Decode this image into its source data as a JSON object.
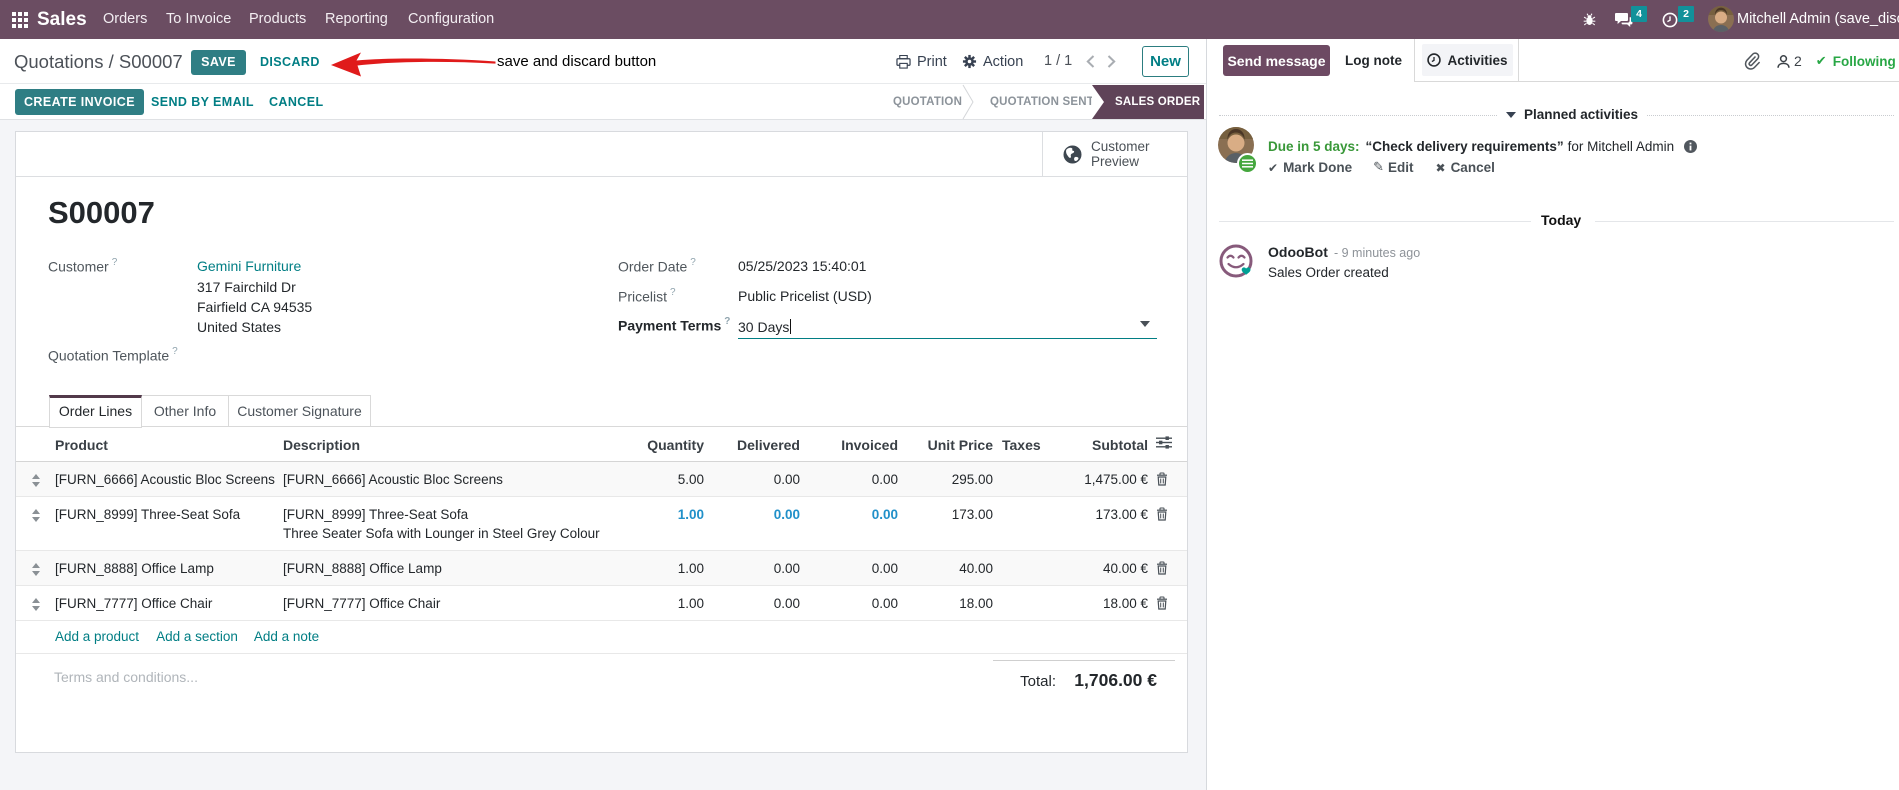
{
  "navbar": {
    "app_name": "Sales",
    "menus": [
      "Orders",
      "To Invoice",
      "Products",
      "Reporting",
      "Configuration"
    ],
    "messages_badge": "4",
    "activities_badge": "2",
    "user_name": "Mitchell Admin (save_discard"
  },
  "control_panel": {
    "breadcrumb_parent": "Quotations",
    "breadcrumb_separator": " / ",
    "breadcrumb_current": "S00007",
    "save_label": "SAVE",
    "discard_label": "DISCARD",
    "annotation_text": "save and discard button",
    "print_label": "Print",
    "action_label": "Action",
    "pager_value": "1 / 1",
    "new_label": "New"
  },
  "status_bar": {
    "create_invoice_label": "CREATE INVOICE",
    "send_by_email_label": "SEND BY EMAIL",
    "cancel_label": "CANCEL",
    "steps": [
      "QUOTATION",
      "QUOTATION SENT",
      "SALES ORDER"
    ],
    "active_step": "SALES ORDER"
  },
  "sheet": {
    "customer_preview_line1": "Customer",
    "customer_preview_line2": "Preview",
    "title": "S00007",
    "fields": {
      "customer_label": "Customer",
      "customer_value": "Gemini Furniture",
      "address_line1": "317 Fairchild Dr",
      "address_line2": "Fairfield CA 94535",
      "address_line3": "United States",
      "quotation_template_label": "Quotation Template",
      "order_date_label": "Order Date",
      "order_date_value": "05/25/2023 15:40:01",
      "pricelist_label": "Pricelist",
      "pricelist_value": "Public Pricelist (USD)",
      "payment_terms_label": "Payment Terms",
      "payment_terms_value": "30 Days",
      "help_marker": "?"
    },
    "tabs": {
      "order_lines": "Order Lines",
      "other_info": "Other Info",
      "customer_signature": "Customer Signature"
    },
    "table": {
      "headers": {
        "product": "Product",
        "description": "Description",
        "quantity": "Quantity",
        "delivered": "Delivered",
        "invoiced": "Invoiced",
        "unit_price": "Unit Price",
        "taxes": "Taxes",
        "subtotal": "Subtotal"
      },
      "rows": [
        {
          "product": "[FURN_6666] Acoustic Bloc Screens",
          "description": "[FURN_6666] Acoustic Bloc Screens",
          "description2": "",
          "quantity": "5.00",
          "delivered": "0.00",
          "invoiced": "0.00",
          "unit_price": "295.00",
          "taxes": "",
          "subtotal": "1,475.00 €"
        },
        {
          "product": "[FURN_8999] Three-Seat Sofa",
          "description": "[FURN_8999] Three-Seat Sofa",
          "description2": "Three Seater Sofa with Lounger in Steel Grey Colour",
          "quantity": "1.00",
          "delivered": "0.00",
          "invoiced": "0.00",
          "unit_price": "173.00",
          "taxes": "",
          "subtotal": "173.00 €"
        },
        {
          "product": "[FURN_8888] Office Lamp",
          "description": "[FURN_8888] Office Lamp",
          "description2": "",
          "quantity": "1.00",
          "delivered": "0.00",
          "invoiced": "0.00",
          "unit_price": "40.00",
          "taxes": "",
          "subtotal": "40.00 €"
        },
        {
          "product": "[FURN_7777] Office Chair",
          "description": "[FURN_7777] Office Chair",
          "description2": "",
          "quantity": "1.00",
          "delivered": "0.00",
          "invoiced": "0.00",
          "unit_price": "18.00",
          "taxes": "",
          "subtotal": "18.00 €"
        }
      ],
      "add_product": "Add a product",
      "add_section": "Add a section",
      "add_note": "Add a note"
    },
    "terms_placeholder": "Terms and conditions...",
    "total_label": "Total:",
    "total_value": "1,706.00 €"
  },
  "chatter": {
    "send_message_label": "Send message",
    "log_note_label": "Log note",
    "activities_label": "Activities",
    "followers_count": "2",
    "following_label": "Following",
    "planned_activities_label": "Planned activities",
    "activity": {
      "due": "Due in 5 days:",
      "summary": "“Check delivery requirements”",
      "assignee": "for Mitchell Admin",
      "mark_done_label": "Mark Done",
      "edit_label": "Edit",
      "cancel_label": "Cancel"
    },
    "today_label": "Today",
    "message": {
      "author": "OdooBot",
      "time": "- 9 minutes ago",
      "body": "Sales Order created"
    }
  },
  "colors": {
    "brand_plum": "#6b4d62",
    "accent_teal": "#017e84",
    "solid_button_teal": "#2f7e84",
    "status_active_plum": "#5f4358",
    "modified_value_blue": "#2090c9",
    "success_green": "#28a745",
    "annotation_red": "#e01b1b"
  }
}
